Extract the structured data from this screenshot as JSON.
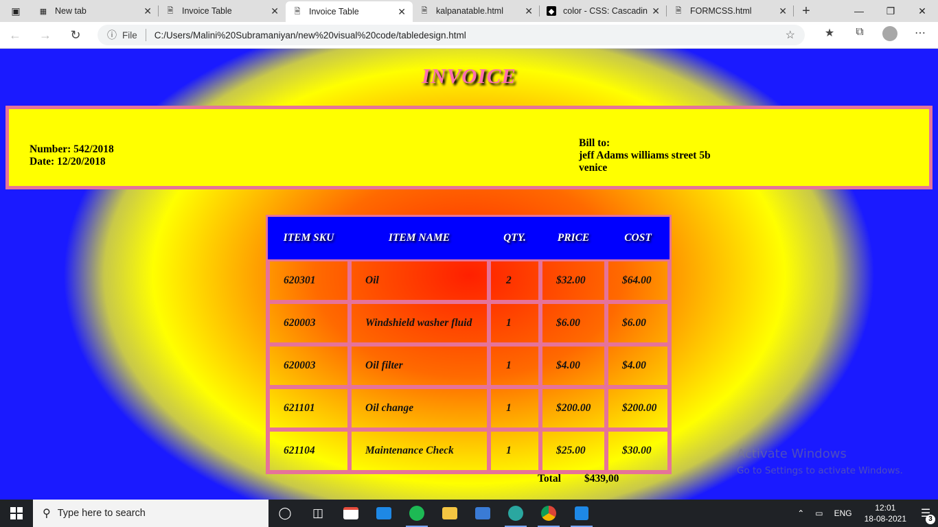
{
  "browser": {
    "tabs": [
      {
        "title": "New tab",
        "icon": "newtab-icon",
        "active": false
      },
      {
        "title": "Invoice Table",
        "icon": "page-icon",
        "active": false
      },
      {
        "title": "Invoice Table",
        "icon": "page-icon",
        "active": true
      },
      {
        "title": "kalpanatable.html",
        "icon": "page-icon",
        "active": false
      },
      {
        "title": "color - CSS: Cascading",
        "icon": "codepen-icon",
        "active": false
      },
      {
        "title": "FORMCSS.html",
        "icon": "page-icon",
        "active": false
      }
    ],
    "address": {
      "scheme_label": "File",
      "url": "C:/Users/Malini%20Subramaniyan/new%20visual%20code/tabledesign.html"
    }
  },
  "invoice": {
    "title": "INVOICE",
    "number_line": "Number: 542/2018",
    "date_line": "Date: 12/20/2018",
    "bill_to_label": "Bill to:",
    "bill_to_line1": "jeff Adams williams street 5b",
    "bill_to_line2": "venice",
    "headers": [
      "ITEM SKU",
      "ITEM NAME",
      "QTY.",
      "PRICE",
      "COST"
    ],
    "rows": [
      {
        "sku": "620301",
        "name": "Oil",
        "qty": "2",
        "price": "$32.00",
        "cost": "$64.00"
      },
      {
        "sku": "620003",
        "name": "Windshield washer fluid",
        "qty": "1",
        "price": "$6.00",
        "cost": "$6.00"
      },
      {
        "sku": "620003",
        "name": "Oil filter",
        "qty": "1",
        "price": "$4.00",
        "cost": "$4.00"
      },
      {
        "sku": "621101",
        "name": "Oil change",
        "qty": "1",
        "price": "$200.00",
        "cost": "$200.00"
      },
      {
        "sku": "621104",
        "name": "Maintenance Check",
        "qty": "1",
        "price": "$25.00",
        "cost": "$30.00"
      }
    ],
    "total_label": "Total",
    "total_value": "$439,00"
  },
  "watermark": {
    "line1": "Activate Windows",
    "line2": "Go to Settings to activate Windows."
  },
  "taskbar": {
    "search_placeholder": "Type here to search",
    "language": "ENG",
    "time": "12:01",
    "date": "18-08-2021",
    "notification_count": "3"
  },
  "colors": {
    "header_bg": "#0000ff",
    "border_pink": "#e67399",
    "info_box_bg": "#ffff00",
    "title_pink": "#ff6fb0"
  }
}
